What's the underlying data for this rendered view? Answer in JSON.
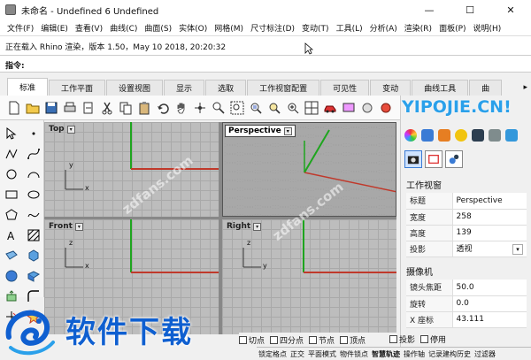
{
  "window": {
    "title": "未命名 - Undefined 6 Undefined",
    "minimize": "—",
    "maximize": "☐",
    "close": "✕"
  },
  "menu": [
    "文件(F)",
    "编辑(E)",
    "查看(V)",
    "曲线(C)",
    "曲面(S)",
    "实体(O)",
    "网格(M)",
    "尺寸标注(D)",
    "变动(T)",
    "工具(L)",
    "分析(A)",
    "渲染(R)",
    "面板(P)",
    "说明(H)"
  ],
  "command": {
    "history": "正在载入 Rhino 渲染，版本 1.50，May 10 2018, 20:20:32",
    "prompt": "指令:"
  },
  "tabs": [
    "标准",
    "工作平面",
    "设置视图",
    "显示",
    "选取",
    "工作视窗配置",
    "可见性",
    "变动",
    "曲线工具",
    "曲"
  ],
  "tab_scroll": "▸",
  "toolbar_icons": [
    "new-file-icon",
    "open-folder-icon",
    "save-icon",
    "print-icon",
    "import-icon",
    "cut-icon",
    "copy-icon",
    "paste-icon",
    "undo-icon",
    "pan-hand-icon",
    "rotate-view-icon",
    "zoom-dynamic-icon",
    "zoom-window-icon",
    "zoom-extents-icon",
    "zoom-selected-icon",
    "zoom-all-icon",
    "four-viewports-icon",
    "car-render-icon",
    "render-icon",
    "ghosted-icon",
    "shaded-icon",
    "light-icon",
    "lock-icon",
    "sphere-icon",
    "properties-icon",
    "layer-icon"
  ],
  "left_tools": [
    "select-arrow-icon",
    "point-icon",
    "polyline-icon",
    "curve-icon",
    "circle-icon",
    "arc-icon",
    "rectangle-icon",
    "ellipse-icon",
    "polygon-icon",
    "free-curve-icon",
    "text-icon",
    "hatch-icon",
    "surface-icon",
    "cube-icon",
    "sphere-solid-icon",
    "mesh-icon",
    "extrude-icon",
    "fillet-icon",
    "trim-icon",
    "explode-icon"
  ],
  "viewports": [
    {
      "name": "Top",
      "active": false,
      "axis_x": "x",
      "axis_y": "y"
    },
    {
      "name": "Perspective",
      "active": true
    },
    {
      "name": "Front",
      "active": false,
      "axis_x": "x",
      "axis_y": "z"
    },
    {
      "name": "Right",
      "active": false,
      "axis_x": "y",
      "axis_y": "z"
    }
  ],
  "dd_arrow": "▾",
  "colors": {
    "grid": "#bdbdbd",
    "grid_line": "#a9a9a9",
    "x_axis": "#c0392b",
    "y_axis": "#1ea51e",
    "accent": "#3a7bd5"
  },
  "panel": {
    "viewport_section": "工作视窗",
    "viewport_props": [
      {
        "label": "标题",
        "value": "Perspective"
      },
      {
        "label": "宽度",
        "value": "258"
      },
      {
        "label": "高度",
        "value": "139"
      },
      {
        "label": "投影",
        "value": "透视",
        "dropdown": true
      }
    ],
    "camera_section": "摄像机",
    "camera_props": [
      {
        "label": "镜头焦距",
        "value": "50.0"
      },
      {
        "label": "旋转",
        "value": "0.0"
      },
      {
        "label": "X 座标",
        "value": "43.111"
      }
    ]
  },
  "osnap": [
    {
      "label": "切点"
    },
    {
      "label": "四分点"
    },
    {
      "label": "节点"
    },
    {
      "label": "顶点"
    },
    {
      "label": "投影"
    },
    {
      "label": "停用"
    }
  ],
  "status": [
    "锁定格点",
    "正交",
    "平面模式",
    "物件锁点",
    "智慧轨迹",
    "操作轴",
    "记录建构历史",
    "过滤器"
  ],
  "watermark": {
    "logo": "软件下载",
    "site": "YIPOJIE.CN!",
    "diag": "zdfans.com"
  }
}
